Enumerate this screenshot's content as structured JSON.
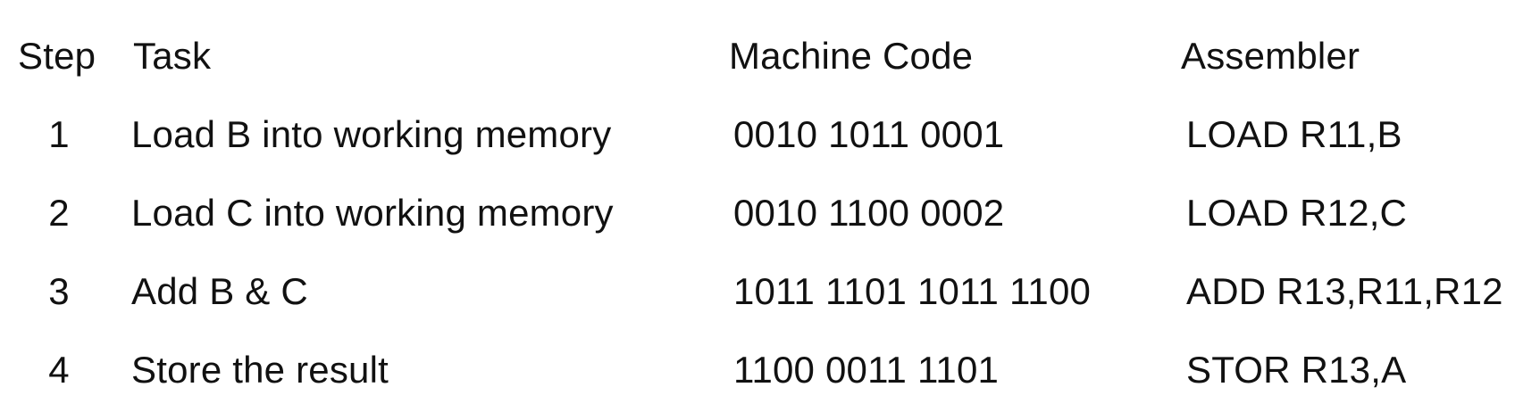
{
  "headers": {
    "step": "Step",
    "task": "Task",
    "machine_code": "Machine Code",
    "assembler": "Assembler"
  },
  "rows": [
    {
      "step": "1",
      "task": "Load B into working memory",
      "machine_code": "0010 1011 0001",
      "assembler": "LOAD R11,B"
    },
    {
      "step": "2",
      "task": "Load C into working memory",
      "machine_code": "0010 1100 0002",
      "assembler": "LOAD R12,C"
    },
    {
      "step": "3",
      "task": "Add B & C",
      "machine_code": "1011 1101 1011 1100",
      "assembler": "ADD R13,R11,R12"
    },
    {
      "step": "4",
      "task": "Store the result",
      "machine_code": "1100 0011 1101",
      "assembler": "STOR R13,A"
    }
  ]
}
